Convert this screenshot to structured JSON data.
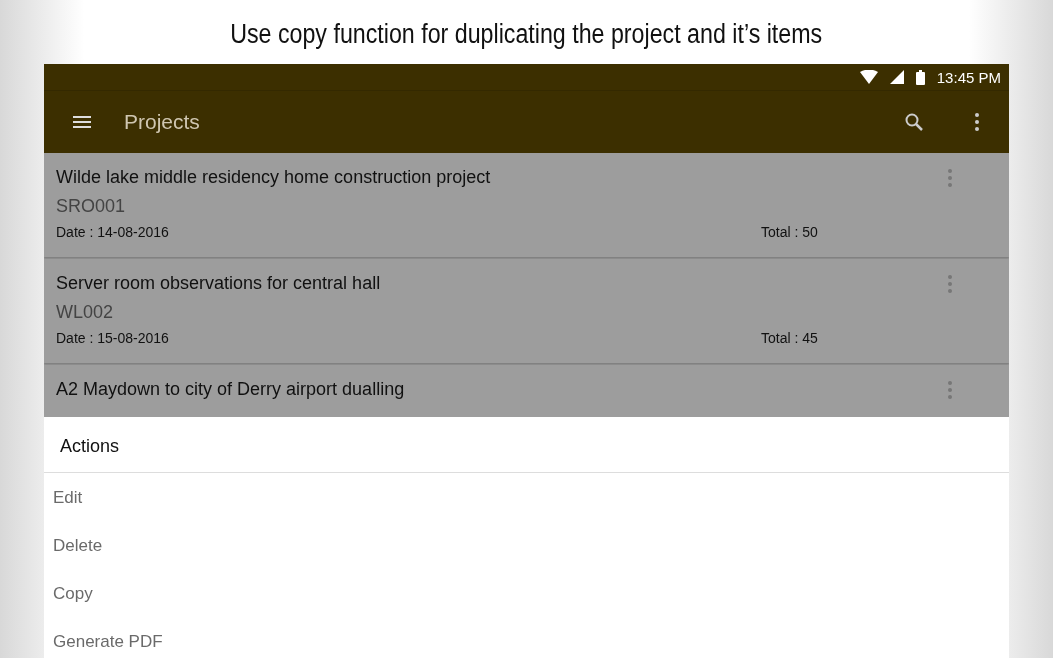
{
  "caption": "Use copy function for duplicating the project and it’s items",
  "status_bar": {
    "time": "13:45 PM"
  },
  "toolbar": {
    "title": "Projects"
  },
  "projects": [
    {
      "title": "Wilde lake middle residency home construction project",
      "code": "SRO001",
      "date": "Date : 14-08-2016",
      "total": "Total : 50"
    },
    {
      "title": "Server room observations for central hall",
      "code": "WL002",
      "date": "Date : 15-08-2016",
      "total": "Total : 45"
    },
    {
      "title": "A2 Maydown to city of Derry airport  dualling"
    }
  ],
  "action_sheet": {
    "title": "Actions",
    "items": [
      "Edit",
      "Delete",
      "Copy",
      "Generate PDF"
    ]
  }
}
